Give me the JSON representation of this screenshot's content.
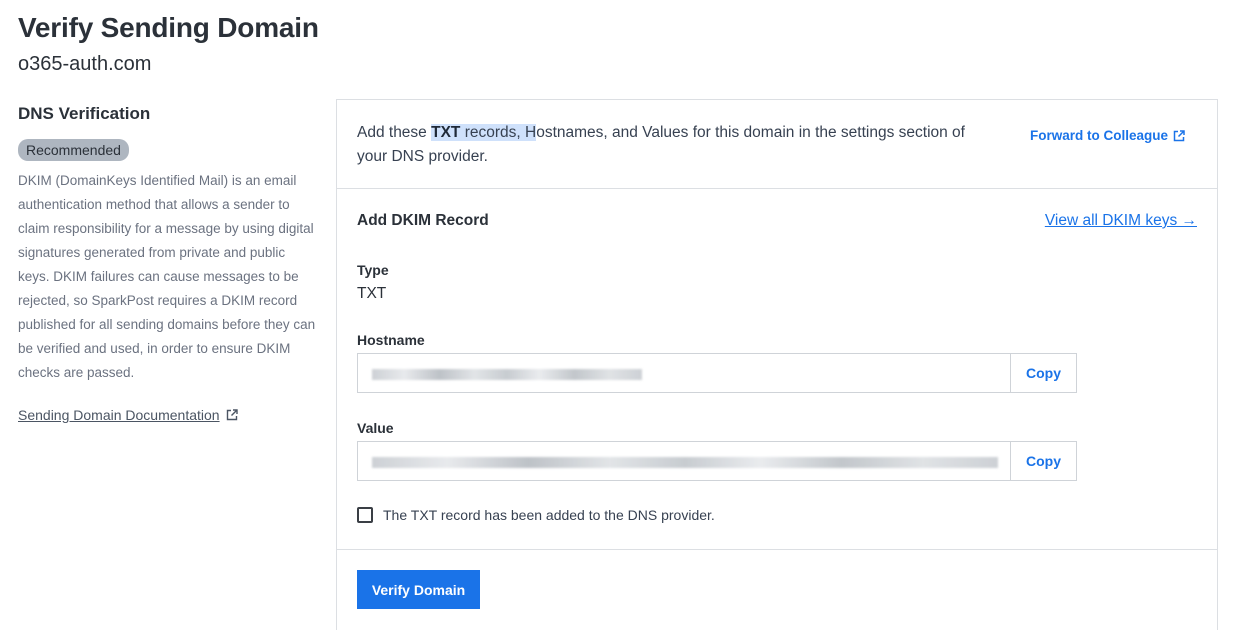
{
  "header": {
    "title": "Verify Sending Domain",
    "domain": "o365-auth.com"
  },
  "sidebar": {
    "section_title": "DNS Verification",
    "badge": "Recommended",
    "description": "DKIM (DomainKeys Identified Mail) is an email authentication method that allows a sender to claim responsibility for a message by using digital signatures generated from private and public keys. DKIM failures can cause messages to be rejected, so SparkPost requires a DKIM record published for all sending domains before they can be verified and used, in order to ensure DKIM checks are passed.",
    "doc_link": "Sending Domain Documentation"
  },
  "intro": {
    "prefix": "Add these ",
    "bold": "TXT",
    "highlighted_rest": " records, H",
    "rest": "ostnames, and Values for this domain in the settings section of your DNS provider.",
    "forward_link": "Forward to Colleague"
  },
  "dkim": {
    "title": "Add DKIM Record",
    "view_keys": "View all DKIM keys →",
    "type_label": "Type",
    "type_value": "TXT",
    "hostname_label": "Hostname",
    "value_label": "Value",
    "copy_label": "Copy",
    "checkbox_label": "The TXT record has been added to the DNS provider."
  },
  "actions": {
    "verify_label": "Verify Domain"
  },
  "colors": {
    "accent": "#1a73e8",
    "badge_bg": "#aeb6c0",
    "highlight": "#cfe1fb"
  }
}
